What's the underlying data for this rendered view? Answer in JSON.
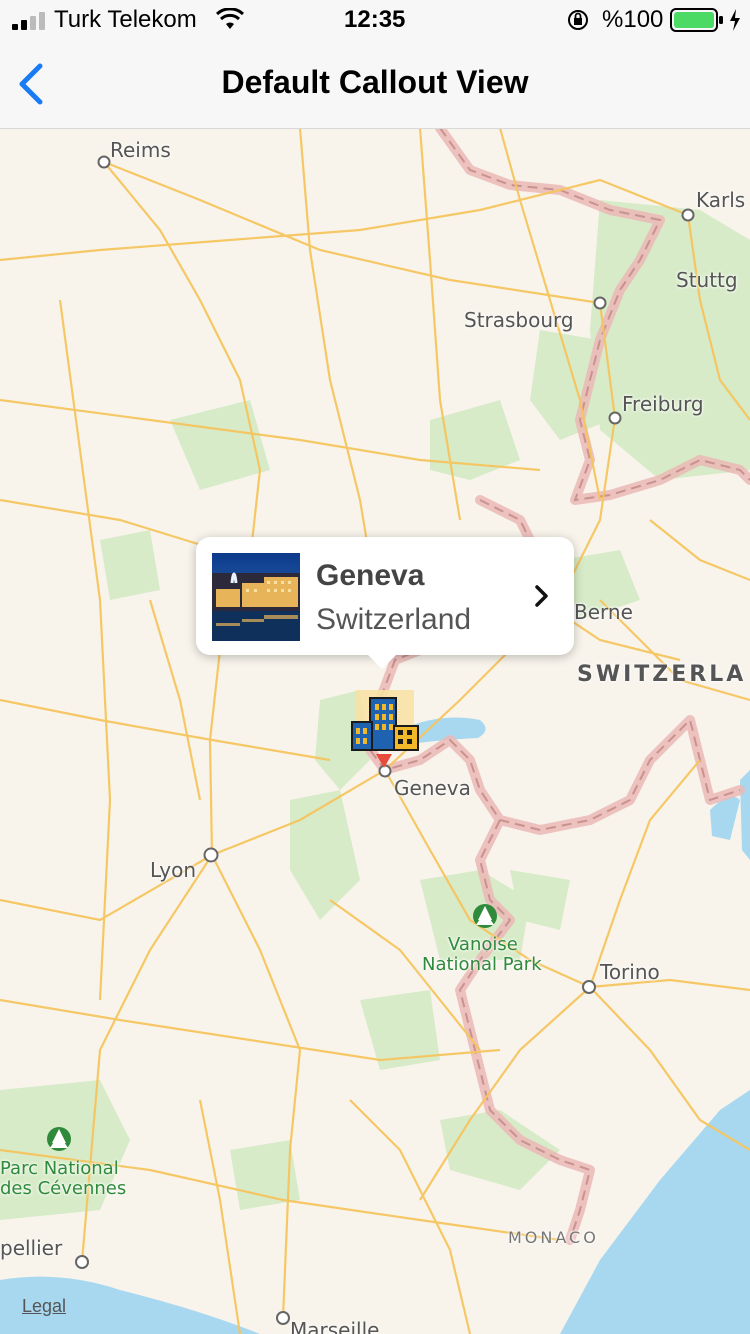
{
  "status": {
    "carrier": "Turk Telekom",
    "time": "12:35",
    "battery_text": "%100",
    "icons": [
      "signal-icon",
      "wifi-icon",
      "orientation-lock-icon",
      "battery-icon",
      "charging-icon"
    ]
  },
  "nav": {
    "title": "Default Callout View",
    "back_icon": "chevron-left-icon",
    "accent": "#1a7cf4"
  },
  "map": {
    "colors": {
      "land": "#f8f4ec",
      "park": "#d7ebc8",
      "water": "#a8d8f0",
      "road": "#f6c55e",
      "border": "#e9b3b0"
    },
    "labels": {
      "reims": "Reims",
      "karlsruhe": "Karls",
      "stuttgart": "Stuttg",
      "strasbourg": "Strasbourg",
      "freiburg": "Freiburg",
      "berne": "Berne",
      "switzerland": "SWITZERLA",
      "geneva": "Geneva",
      "lyon": "Lyon",
      "vanoise": "Vanoise",
      "vanoise_np": "National Park",
      "torino": "Torino",
      "cevennes1": "Parc National",
      "cevennes2": "des Cévennes",
      "montpellier": "pellier",
      "monaco": "MONACO",
      "marseille": "Marseille",
      "legal": "Legal"
    }
  },
  "callout": {
    "title": "Geneva",
    "subtitle": "Switzerland",
    "accessory_icon": "chevron-right-icon"
  },
  "annotation": {
    "icon": "building-pin-icon"
  }
}
